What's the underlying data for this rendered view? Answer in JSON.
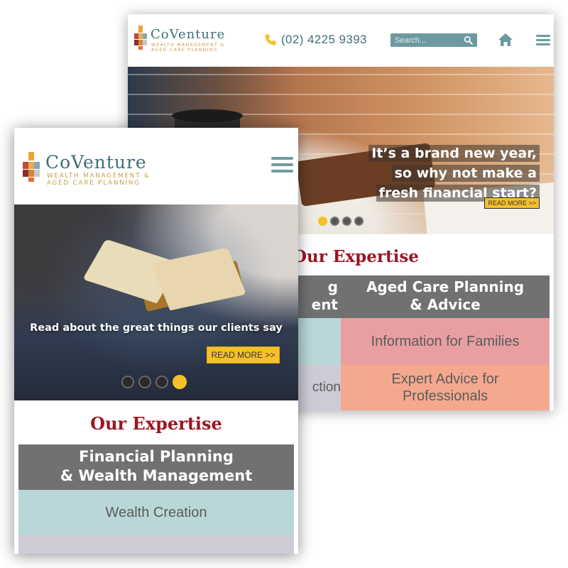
{
  "tablet": {
    "logo": {
      "name": "CoVenture",
      "tagline_1": "WEALTH MANAGEMENT &",
      "tagline_2": "AGED CARE PLANNING"
    },
    "phone_icon": "phone-icon",
    "phone_number": "(02) 4225 9393",
    "search": {
      "placeholder": "Search..."
    },
    "hero": {
      "headline_lines": [
        "It’s a brand new year,",
        "so why not make a",
        "fresh financial start?"
      ],
      "cta": "READ MORE >>",
      "slides": 4,
      "active_slide": 1
    },
    "expertise": {
      "title": "Our Expertise",
      "left_column": {
        "heading_lines": [
          "g",
          "ent"
        ],
        "items": [
          "",
          "ction"
        ]
      },
      "right_column": {
        "heading_lines": [
          "Aged Care Planning",
          "& Advice"
        ],
        "items": [
          "Information for Families",
          "Expert Advice for Professionals"
        ]
      }
    }
  },
  "phone": {
    "logo": {
      "name": "CoVenture",
      "tagline_1": "WEALTH MANAGEMENT &",
      "tagline_2": "AGED CARE PLANNING"
    },
    "hero": {
      "caption": "Read about the great things our clients say",
      "cta": "READ MORE >>",
      "slides": 4,
      "active_slide": 4
    },
    "expertise": {
      "title": "Our Expertise",
      "column": {
        "heading_lines": [
          "Financial Planning",
          "& Wealth Management"
        ],
        "items": [
          "Wealth Creation"
        ]
      }
    }
  },
  "colors": {
    "teal": "#6d9aa1",
    "logo_teal": "#3f6f78",
    "logo_gold": "#c99b4a",
    "crimson": "#9b1622",
    "yellow": "#f6c02a",
    "grid_header": "#717171",
    "wealth_teal": "#b9d7d8",
    "aged_pink": "#e99fa2",
    "aged_salmon": "#f4a98f",
    "lavender": "#cfcbd6"
  }
}
